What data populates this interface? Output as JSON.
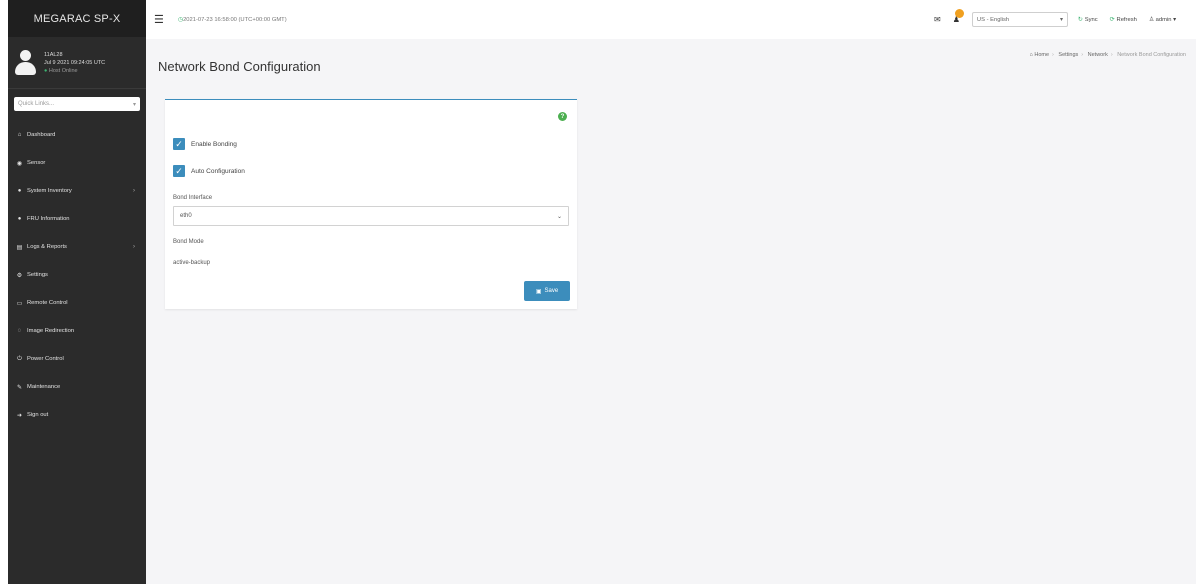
{
  "brand": "MEGARAC SP-X",
  "user": {
    "name": "11AL28",
    "time": "Jul 9 2021 09:24:05 UTC",
    "status": "Host Online",
    "status_color": "#3cb371"
  },
  "quick_links": {
    "placeholder": "Quick Links..."
  },
  "nav": [
    {
      "label": "Dashboard",
      "icon": "dashboard-icon",
      "has_arrow": false
    },
    {
      "label": "Sensor",
      "icon": "sensor-icon",
      "has_arrow": false
    },
    {
      "label": "System Inventory",
      "icon": "system-inventory-icon",
      "has_arrow": true
    },
    {
      "label": "FRU Information",
      "icon": "fru-icon",
      "has_arrow": false
    },
    {
      "label": "Logs & Reports",
      "icon": "logs-icon",
      "has_arrow": true
    },
    {
      "label": "Settings",
      "icon": "settings-icon",
      "has_arrow": false
    },
    {
      "label": "Remote Control",
      "icon": "remote-control-icon",
      "has_arrow": false
    },
    {
      "label": "Image Redirection",
      "icon": "image-redirection-icon",
      "has_arrow": false
    },
    {
      "label": "Power Control",
      "icon": "power-icon",
      "has_arrow": false
    },
    {
      "label": "Maintenance",
      "icon": "wrench-icon",
      "has_arrow": false
    },
    {
      "label": "Sign out",
      "icon": "sign-out-icon",
      "has_arrow": false
    }
  ],
  "topbar": {
    "datetime": "2021-07-23 16:58:00 (UTC+00:00 GMT)",
    "language": "US - English",
    "sync_label": "Sync",
    "refresh_label": "Refresh",
    "user_label": "admin"
  },
  "page": {
    "title": "Network Bond Configuration",
    "breadcrumb": [
      "Home",
      "Settings",
      "Network",
      "Network Bond Configuration"
    ]
  },
  "form": {
    "enable_bonding": {
      "label": "Enable Bonding",
      "checked": true
    },
    "auto_config": {
      "label": "Auto Configuration",
      "checked": true
    },
    "bond_interface": {
      "label": "Bond Interface",
      "value": "eth0"
    },
    "bond_mode": {
      "label": "Bond Mode",
      "value": "active-backup"
    },
    "save_label": "Save"
  },
  "colors": {
    "sidebar": "#2b2b2b",
    "accent": "#3c8dbc",
    "help": "#4caf50",
    "notification": "#f0a020"
  }
}
